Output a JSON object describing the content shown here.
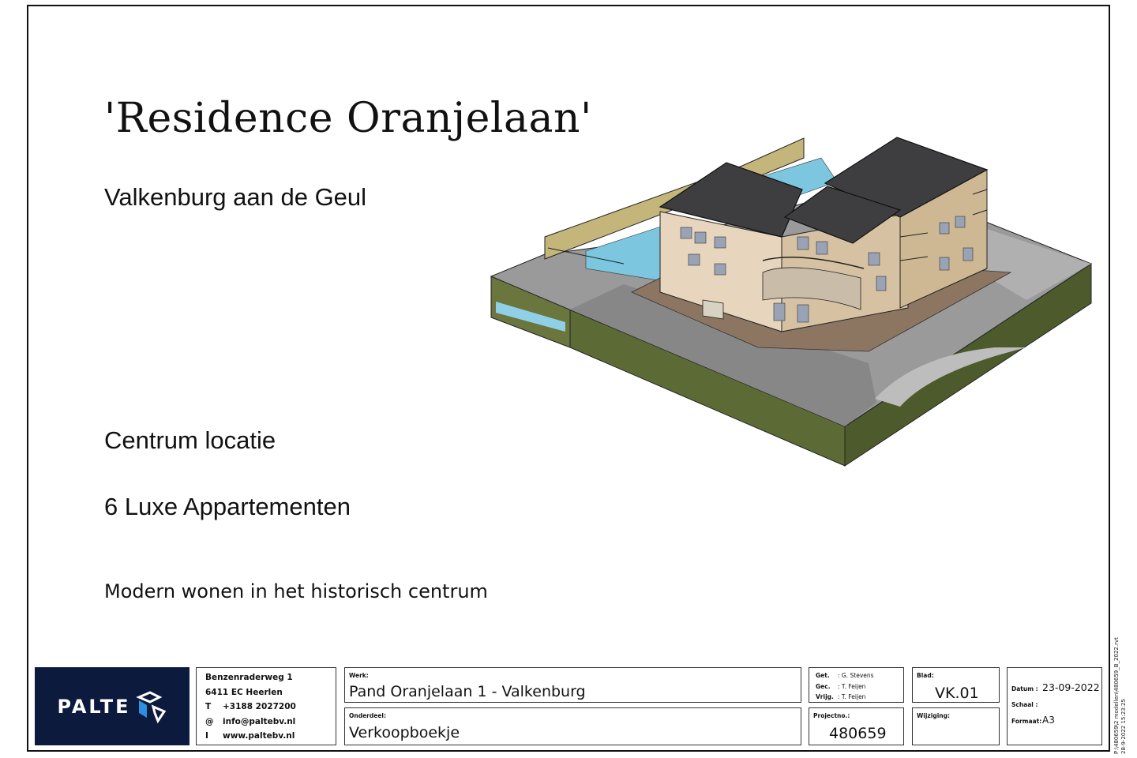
{
  "title": "'Residence Oranjelaan'",
  "subtitle": "Valkenburg aan de Geul",
  "location": "Centrum locatie",
  "apartments": "6 Luxe Appartementen",
  "tagline": "Modern wonen in het historisch centrum",
  "logo": {
    "text": "PALTE",
    "icon": "palte-arrow-logo-icon"
  },
  "address": {
    "street": "Benzenraderweg 1",
    "city": "6411 EC  Heerlen",
    "phone_key": "T",
    "phone": "+3188 2027200",
    "email_key": "@",
    "email": "info@paltebv.nl",
    "web_key": "I",
    "web": "www.paltebv.nl"
  },
  "werk": {
    "label": "Werk:",
    "value": "Pand Oranjelaan 1 - Valkenburg"
  },
  "onderdeel": {
    "label": "Onderdeel:",
    "value": "Verkoopboekje"
  },
  "people": {
    "get_label": "Get.",
    "get": "G. Stevens",
    "gec_label": "Gec.",
    "gec": "T. Feijen",
    "vrijg_label": "Vrijg.",
    "vrijg": "T. Feijen"
  },
  "projectno": {
    "label": "Projectno.:",
    "value": "480659"
  },
  "blad": {
    "label": "Blad:",
    "value": "VK.01"
  },
  "wijziging": {
    "label": "Wijziging:"
  },
  "datum": {
    "label": "Datum :",
    "value": "23-09-2022"
  },
  "schaal": {
    "label": "Schaal :"
  },
  "formaat": {
    "label": "Formaat:",
    "value": "A3"
  },
  "side_text": {
    "line1": "P:\\480659\\2 modellen\\480659_B_2022.rvt",
    "line2": "28-9-2022 15:23:25"
  }
}
